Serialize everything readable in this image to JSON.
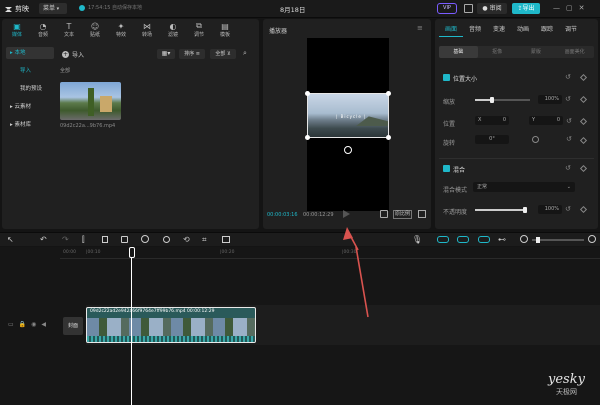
{
  "app": {
    "name": "剪映",
    "menu_label": "菜单",
    "autosave": "17:54:15 自动保存本地",
    "project_title": "8月18日",
    "vip_label": "VIP",
    "share_label": "审阅",
    "export_label": "导出"
  },
  "toolbar": [
    {
      "label": "媒体",
      "icon": "media-icon",
      "active": true
    },
    {
      "label": "音频",
      "icon": "audio-icon"
    },
    {
      "label": "文本",
      "icon": "text-icon"
    },
    {
      "label": "贴纸",
      "icon": "sticker-icon"
    },
    {
      "label": "特效",
      "icon": "effects-icon"
    },
    {
      "label": "转场",
      "icon": "transition-icon"
    },
    {
      "label": "滤镜",
      "icon": "filter-icon"
    },
    {
      "label": "调节",
      "icon": "adjust-icon"
    },
    {
      "label": "模板",
      "icon": "template-icon"
    }
  ],
  "sidebar": [
    {
      "label": "▸ 本地",
      "active": true
    },
    {
      "label": "导入",
      "sub": true
    },
    {
      "label": "我的预设",
      "sub": true
    },
    {
      "label": "▸ 云素材"
    },
    {
      "label": "▸ 素材库"
    }
  ],
  "media": {
    "import_label": "导入",
    "sort_label": "排序",
    "all_label": "全部",
    "section": "全部",
    "file_name": "09d2c22a...9b76.mp4"
  },
  "player": {
    "title": "播放器",
    "current_time": "00:00:03:16",
    "total_time": "00:00:12:29",
    "overlay_text": "| Bicycle |",
    "ratio_label": "原比例"
  },
  "inspector": {
    "tabs": [
      "画面",
      "音频",
      "变速",
      "动画",
      "跟踪",
      "调节"
    ],
    "subtabs": [
      "基础",
      "抠像",
      "蒙版",
      "画面美化"
    ],
    "size_section": "位置大小",
    "scale_label": "缩放",
    "scale_value": "100%",
    "position_label": "位置",
    "x_label": "X",
    "x_value": "0",
    "y_label": "Y",
    "y_value": "0",
    "rotate_label": "旋转",
    "rotate_value": "0°",
    "blend_section": "混合",
    "blend_mode_label": "混合模式",
    "blend_mode_value": "正常",
    "opacity_label": "不透明度",
    "opacity_value": "100%",
    "scale_level": 0.3,
    "opacity_level": 1.0
  },
  "timeline": {
    "ruler": [
      "00:00",
      "|00:10",
      "|00:20",
      "|00:30"
    ],
    "cover_label": "封面",
    "clip_name": "09d2c22ad2e942a66f9764e7ff99b76.mp4",
    "clip_duration": "00:00:12:29"
  },
  "watermark": {
    "brand": "yesky",
    "sub": "天极网"
  },
  "colors": {
    "accent": "#1fb8c9",
    "arrow": "#d9534f"
  }
}
